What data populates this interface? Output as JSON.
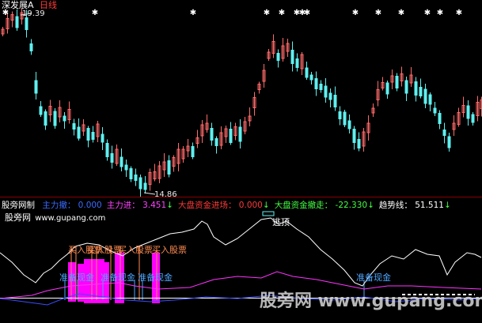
{
  "header": {
    "stock_name": "深发展A",
    "period": "日线",
    "stock_color": "#ffffff",
    "period_color": "#ff3b3b"
  },
  "price_chart": {
    "high_label": "19.39",
    "low_label": "14.86",
    "up_color": "#ff6a6a",
    "down_color": "#5ff0f0",
    "marker_glyph": "✱",
    "marker_color": "#ffffff"
  },
  "indicator": {
    "name": "股旁网制",
    "items": [
      {
        "label": "主力撤：",
        "value": "0.000",
        "color": "#3b6bff"
      },
      {
        "label": "主力进：",
        "value": "3.451",
        "color": "#ff44ff",
        "arrow": "↓"
      },
      {
        "label": "大盘资金进场：",
        "value": "0.000",
        "color": "#ff3b3b",
        "arrow": "↓"
      },
      {
        "label": "大盘资金撤走：",
        "value": "-22.330",
        "color": "#44ff44",
        "arrow": "↓"
      },
      {
        "label": "趋势线：",
        "value": "51.511",
        "color": "#ffffff",
        "arrow": "↓"
      }
    ],
    "name_color": "#ffffff",
    "arrow_color": "#44ff44"
  },
  "sub_chart": {
    "site_name": "股旁网",
    "site_url": "www.gupang.com",
    "escape_label": "逃顶",
    "buy_labels": [
      "买入股票",
      "买入股票",
      "买入股票",
      "买入股票"
    ],
    "cash_labels": [
      "准备现金",
      "准备现金",
      "准备现金",
      "准备现金"
    ],
    "buy_color": "#ff8c50",
    "cash_color": "#4ea6ff",
    "trend_color": "#ffffff",
    "blue_color": "#3b4bff",
    "magenta_color": "#ff33ff",
    "bar_color": "#ff00ff"
  },
  "watermark": {
    "text": "股旁网 www.gupang.com"
  }
}
